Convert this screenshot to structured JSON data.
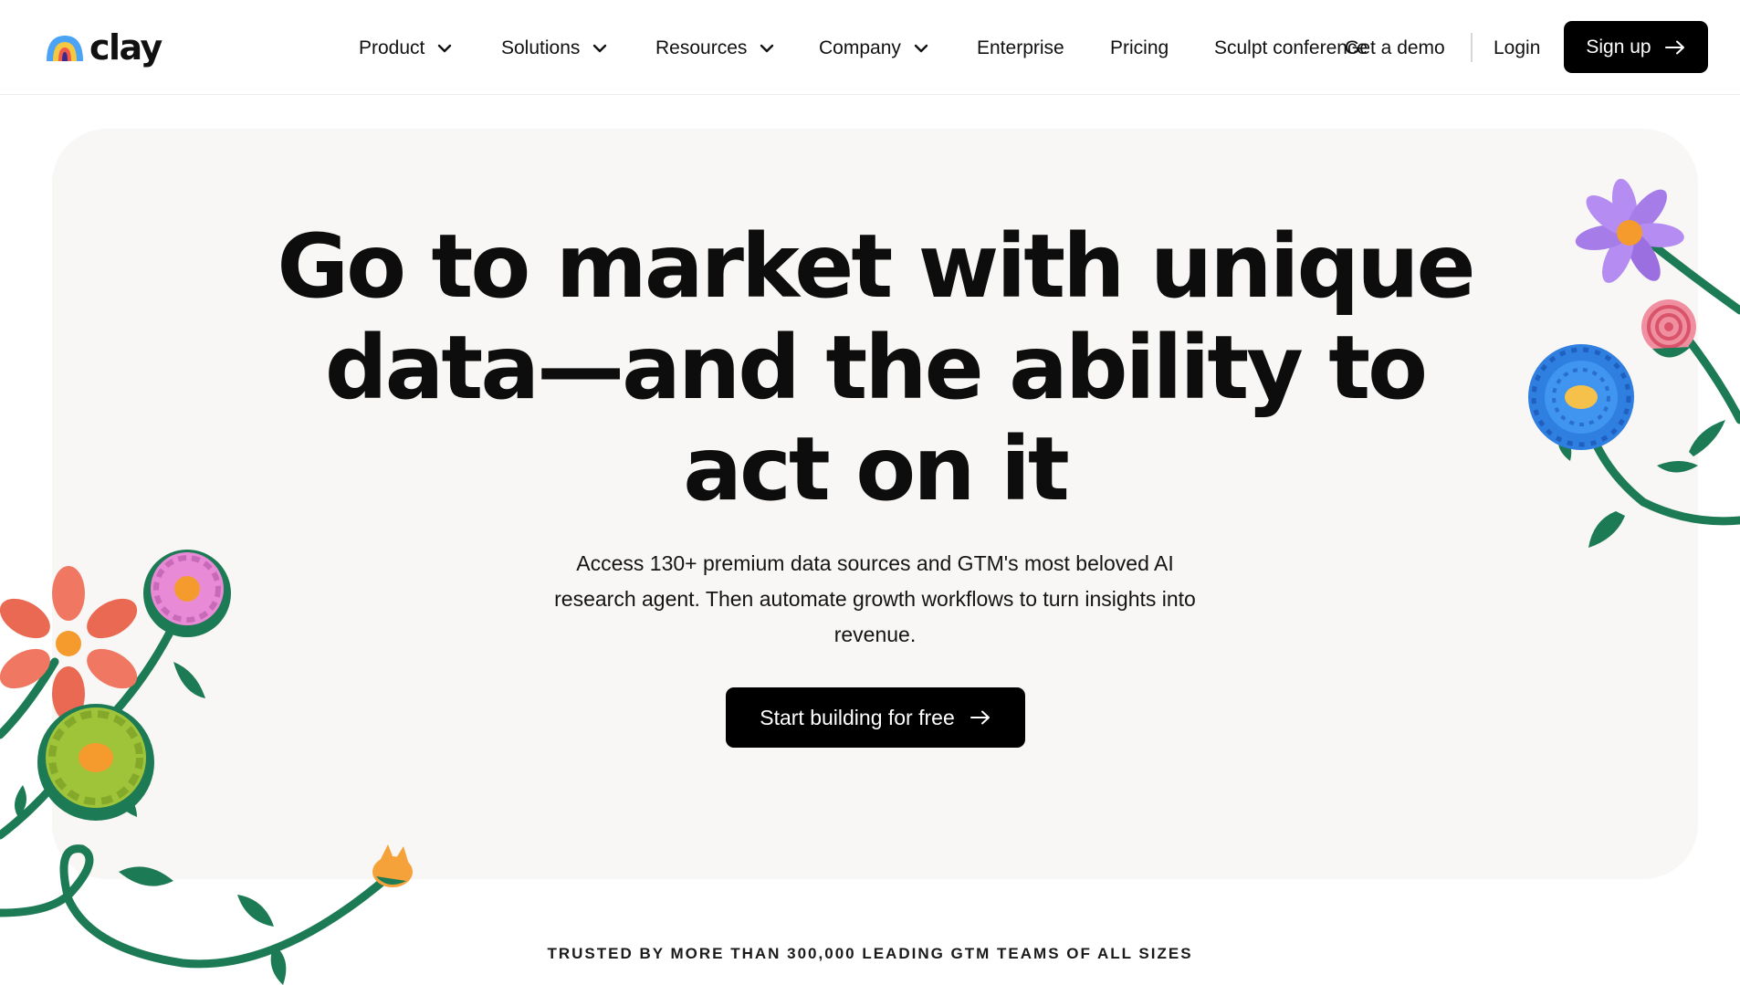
{
  "brand": {
    "name": "clay"
  },
  "nav": {
    "items": [
      {
        "label": "Product",
        "has_dropdown": true
      },
      {
        "label": "Solutions",
        "has_dropdown": true
      },
      {
        "label": "Resources",
        "has_dropdown": true
      },
      {
        "label": "Company",
        "has_dropdown": true
      },
      {
        "label": "Enterprise",
        "has_dropdown": false
      },
      {
        "label": "Pricing",
        "has_dropdown": false
      },
      {
        "label": "Sculpt conference",
        "has_dropdown": false
      },
      {
        "label": "Get a demo",
        "has_dropdown": false
      }
    ],
    "login": "Login",
    "signup": "Sign up"
  },
  "hero": {
    "title_lines": [
      "Go to market with unique",
      "data—and the ability to",
      "act on it"
    ],
    "subtitle_lines": [
      "Access 130+ premium data sources and GTM's most beloved AI",
      "research agent. Then automate growth workflows to turn insights into",
      "revenue."
    ],
    "cta": "Start building for free"
  },
  "trusted": "TRUSTED BY MORE THAN 300,000 LEADING GTM TEAMS OF ALL SIZES",
  "colors": {
    "background": "#ffffff",
    "hero_background": "#f8f7f5",
    "button": "#000000",
    "stem": "#1c7a55"
  }
}
